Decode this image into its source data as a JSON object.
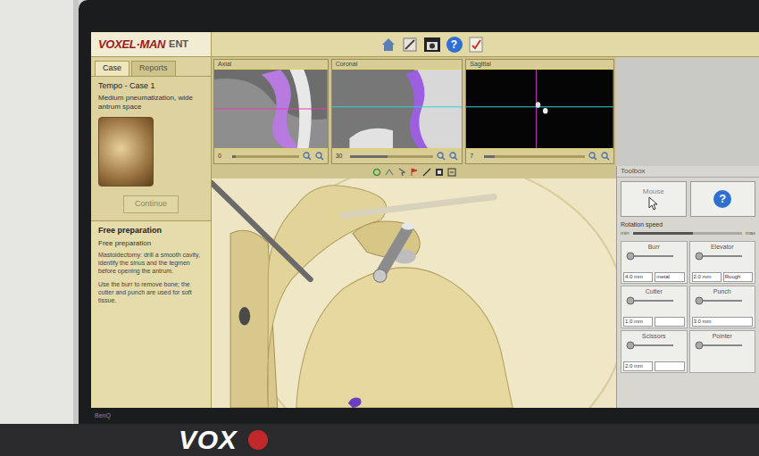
{
  "app": {
    "logo": "VOXEL·MAN",
    "product": "ENT"
  },
  "toolbar": {
    "help_icon": "?"
  },
  "tabs": [
    {
      "label": "Case",
      "selected": true
    },
    {
      "label": "Reports",
      "selected": false
    }
  ],
  "case": {
    "title": "Tempo - Case 1",
    "description": "Medium pneumatization, wide antrum space",
    "button": "Continue"
  },
  "task": {
    "title": "Free preparation",
    "subtitle": "Free preparation",
    "text": "Mastoidectomy: drill a smooth cavity, identify the sinus and the tegmen before opening the antrum.",
    "note": "Use the burr to remove bone; the cutter and punch are used for soft tissue."
  },
  "views": [
    {
      "label": "Axial",
      "value": "0",
      "level": 0.05
    },
    {
      "label": "Coronal",
      "value": "30",
      "level": 0.45
    },
    {
      "label": "Sagittal",
      "value": "7",
      "level": 0.1
    }
  ],
  "tools": {
    "title": "Toolbox",
    "mouse": "Mouse",
    "help_icon": "?",
    "rotation": {
      "label": "Rotation speed",
      "min": "min",
      "max": "max",
      "level": 0.55
    },
    "items": [
      {
        "label": "Burr",
        "options": [
          "4.0 mm",
          "metal"
        ]
      },
      {
        "label": "Elevator",
        "options": [
          "2.0 mm",
          "Rough"
        ]
      },
      {
        "label": "Cutter",
        "options": [
          "1.0 mm",
          ""
        ]
      },
      {
        "label": "Punch",
        "options": [
          "3.0 mm"
        ]
      },
      {
        "label": "Scissors",
        "options": [
          "2.0 mm",
          ""
        ]
      },
      {
        "label": "Pointer",
        "options": []
      }
    ]
  },
  "monitor": {
    "brand": "BenQ"
  },
  "stand": {
    "text": "VOX"
  }
}
